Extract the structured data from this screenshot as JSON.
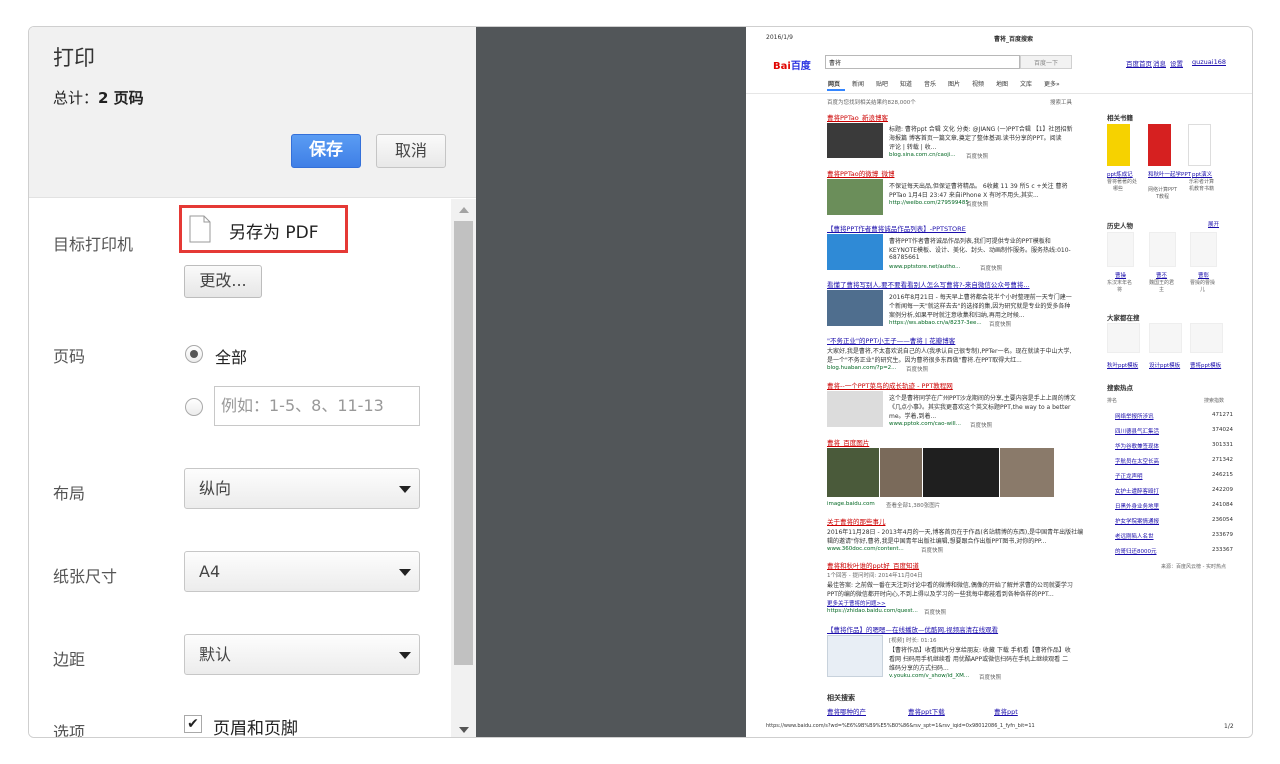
{
  "dialog": {
    "title": "打印",
    "total_label": "总计：",
    "total_value": "2 页码",
    "save_label": "保存",
    "cancel_label": "取消"
  },
  "settings": {
    "destination": {
      "label": "目标打印机",
      "value": "另存为 PDF",
      "change_label": "更改..."
    },
    "pages": {
      "label": "页码",
      "all_label": "全部",
      "selected": "all",
      "custom_placeholder": "例如：1-5、8、11-13"
    },
    "layout": {
      "label": "布局",
      "value": "纵向"
    },
    "paper": {
      "label": "纸张尺寸",
      "value": "A4"
    },
    "margins": {
      "label": "边距",
      "value": "默认"
    },
    "options": {
      "label": "选项",
      "header_footer_label": "页眉和页脚",
      "header_footer_checked": true
    }
  },
  "preview": {
    "date": "2016/1/9",
    "page_title": "曹将_百度搜索",
    "logo_left": "Bai",
    "logo_right": "百度",
    "search_value": "曹将",
    "search_button": "百度一下",
    "top_links": [
      "百度首页",
      "消息",
      "设置",
      "guzuai168"
    ],
    "tabs": [
      "网页",
      "新闻",
      "贴吧",
      "知道",
      "音乐",
      "图片",
      "视频",
      "地图",
      "文库",
      "更多»"
    ],
    "result_count": "百度为您找到相关结果约828,000个",
    "search_tools": "搜索工具",
    "results": [
      {
        "title": "曹将PPTao_新浪博客",
        "lines": [
          "标题: 曹将ppt 合辑 文化 分类: @JIANG (一)PPT合辑 【1】社团招新",
          "海报篇 博客首页一篇文章,奠定了整体基调.读书分享的PPT。阅读",
          "评论 | 转载 | 收..."
        ],
        "url": "blog.sina.com.cn/caoji...",
        "snap": "百度快照"
      },
      {
        "title": "曹将PPTao的微博_微博",
        "lines": [
          "不保证每天出品,但保证曹将精品。 6收藏 11 39 所5 c +关注 曹将",
          "PPTao 1月4日 23:47 来自iPhone X 有时不用头,其实..."
        ],
        "url": "http://weibo.com/279599485",
        "snap": "百度快照"
      },
      {
        "title": "【曹将PPT作者曹将诚品作品列表】-PPTSTORE",
        "lines": [
          "曹将PPT作者曹将诚品作品列表,我们可提供专业的PPT模板和",
          "KEYNOTE模板、设计、美化、封头、动画制作服务。服务热线:010-",
          "68785661"
        ],
        "url": "www.pptstore.net/autho...",
        "snap": "百度快照"
      },
      {
        "title": "看懂了曹将写别人,要不要看看别人怎么写曹将?-来自微信公众号曹将...",
        "lines": [
          "2016年8月21日 - 每天早上曹将都会花半个小时整理前一天专门建一",
          "个新闻每一天\"就这样去去\"的选择的集,因为研究就是专业的受多各种",
          "案例分析,如果平时就注意收集和归纳,再用之时候..."
        ],
        "url": "https://ws.abbao.cn/a/8237-3ee...",
        "snap": "百度快照"
      },
      {
        "title": "\"不务正业\"的PPT小王子——曹将丨花瓣博客",
        "lines": [
          "大家好,我是曹将,不太喜欢说自己的人(我承认自己很专制),PPTer一名。现在就读于中山大学,",
          "是一个\"不务正业\"的研究生。因为曹将很多东西做\"曹将.在PPT取得大红..."
        ],
        "url": "blog.huaban.com/?p=2...",
        "snap": "百度快照"
      },
      {
        "title": "曹将--一个PPT菜鸟的成长轨迹 - PPT教程网",
        "lines": [
          "这个是曹将同学在广州PPT沙龙期间的分享,主要内容是手上上周的博文",
          "《几点小事》。其实我更喜欢这个英文标题PPT,the way to a better",
          "me。学着,到着..."
        ],
        "url": "www.pptok.com/cao-will...",
        "snap": "百度快照"
      },
      {
        "title": "曹将_百度图片",
        "lines": [],
        "url": "image.baidu.com",
        "snap": "查看全部1,380张图片"
      },
      {
        "title": "关于曹将的那些事儿",
        "lines": [
          "2016年11月28日 - 2013年4月的一天,博客首页在于作品(名站精博的东西),是中国青年出版社编",
          "辑的邀请\"你好,曹将,我是中国青年出版社编辑,想要跟合作出版PPT图书,对你的PP..."
        ],
        "url": "www.360doc.com/content...",
        "snap": "百度快照"
      },
      {
        "title": "曹将和秋叶谁的ppt好_百度知道",
        "lines": [
          "1个回答 - 提问时间: 2014年11月04日",
          "最佳答案: 之前做一番在天注到讨论中看的微博和微信,偶像的开始了解并求曹的公司就要学习",
          "PPT的编的微信都开时向心,不到上得以及学习的一些我每中都能看到各种各样的PPT..."
        ],
        "url": "https://zhidao.baidu.com/quest...",
        "snap": "百度快照"
      },
      {
        "title": "【曹将作品】的嗯嗯—在线播放—优酷网,视频高清在线观看",
        "lines": [
          "[视频] 时长: 01:16",
          "【曹将作品】收看图片分享给朋友: 收藏 下载 手机看【曹将作品】收",
          "看网 扫码用手机继续看 用优酷APP或微信扫码在手机上继续观看 二",
          "维码分享的方式扫码..."
        ],
        "url": "v.youku.com/v_show/id_XM...",
        "snap": "百度快照"
      }
    ],
    "more_images": "更多关于曹将的问题>>",
    "related_title": "相关搜索",
    "related": [
      "曹将哪种的产",
      "曹将ppt下载",
      "曹将ppt"
    ],
    "footer_url": "https://www.baidu.com/s?wd=%E6%9B%B9%E5%B0%86&rsv_spt=1&rsv_iqid=0x98012086_1_fyfn_bit=11",
    "footer_page": "1/2",
    "sidebar": {
      "books_title": "相关书籍",
      "books": [
        {
          "title": "ppt炼成记",
          "sub": [
            "曹将著著的处",
            "哪些"
          ]
        },
        {
          "title": "和秋叶一起学PPT",
          "sub": [
            "网络计算PPT",
            "T教程"
          ]
        },
        {
          "title": "ppt演义",
          "sub": [
            "乐彩者计算",
            "机教育书籍"
          ]
        }
      ],
      "people_title": "历史人物",
      "people_more": "展开",
      "people": [
        {
          "name": "曹操",
          "sub": [
            "东汉末年名",
            "将"
          ]
        },
        {
          "name": "曹丕",
          "sub": [
            "魏国王的君",
            "主"
          ]
        },
        {
          "name": "曹彰",
          "sub": [
            "曹操的曹操",
            "儿"
          ]
        }
      ],
      "also_title": "大家都在搜",
      "also": [
        "秋叶ppt模板",
        "设计ppt模板",
        "曹将ppt模板"
      ],
      "hot_title": "搜索热点",
      "hot_col1": "排名",
      "hot_col2": "搜索指数",
      "hot": [
        {
          "title": "网络举报所涉讯",
          "score": "471271"
        },
        {
          "title": "四川德县气汇集活",
          "score": "374024"
        },
        {
          "title": "华为谷歌兼签现体",
          "score": "301331"
        },
        {
          "title": "字航员在太空长高",
          "score": "271342"
        },
        {
          "title": "子正龙声明",
          "score": "246215"
        },
        {
          "title": "女护士遭醉客殴打",
          "score": "242209"
        },
        {
          "title": "日黑外身业务地里",
          "score": "241084"
        },
        {
          "title": "护女学院案情通报",
          "score": "236054"
        },
        {
          "title": "老远刚陷人名世",
          "score": "233679"
        },
        {
          "title": "的哥归还8000元",
          "score": "233367"
        }
      ],
      "source": "来源：百度风云榜 - 实时热点"
    }
  },
  "colors": {
    "primary": "#4a8af4",
    "highlight": "#e53935",
    "gray_area": "#525659",
    "sidebar_top": "#f1f1f1"
  }
}
